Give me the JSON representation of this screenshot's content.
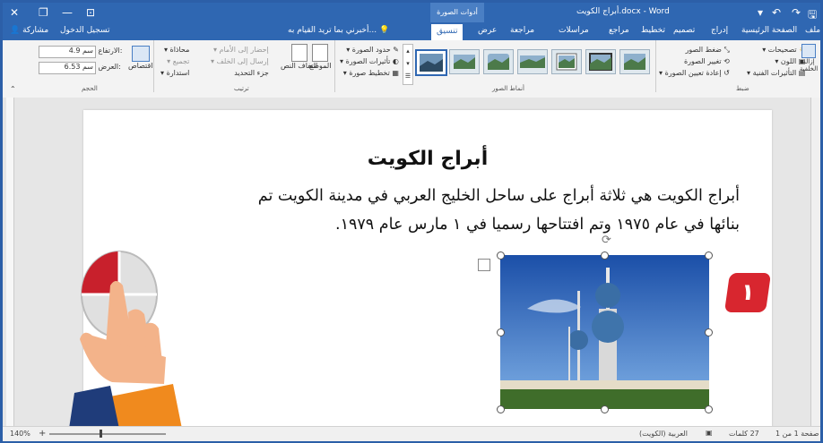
{
  "window": {
    "title": "أبراج الكويت.docx - Word",
    "context_tab_group": "أدوات الصورة",
    "sign_in": "تسجيل الدخول",
    "share": "مشاركة"
  },
  "tabs": [
    {
      "label": "ملف"
    },
    {
      "label": "الصفحة الرئيسية"
    },
    {
      "label": "إدراج"
    },
    {
      "label": "تصميم"
    },
    {
      "label": "تخطيط"
    },
    {
      "label": "مراجع"
    },
    {
      "label": "مراسلات"
    },
    {
      "label": "مراجعة"
    },
    {
      "label": "عرض"
    },
    {
      "label": "تنسيق"
    }
  ],
  "tell_me": "أخبرني بما تريد القيام به...",
  "ribbon": {
    "adjust": {
      "label": "ضبط",
      "remove_bg": "إزالة الخلفية",
      "corrections": "تصحيحات",
      "color": "اللون",
      "artistic": "التأثيرات الفنية",
      "compress": "ضغط الصور",
      "change": "تغيير الصورة",
      "reset": "إعادة تعيين الصورة"
    },
    "styles": {
      "label": "أنماط الصور",
      "border": "حدود الصورة",
      "effects": "تأثيرات الصورة",
      "layout": "تخطيط صورة"
    },
    "arrange": {
      "label": "ترتيب",
      "position": "الموضع",
      "wrap": "التفاف النص",
      "forward": "إحضار إلى الأمام",
      "backward": "إرسال إلى الخلف",
      "selection": "جزء التحديد",
      "align": "محاذاة",
      "group": "تجميع",
      "rotate": "استدارة"
    },
    "size": {
      "label": "الحجم",
      "crop": "اقتصاص",
      "height_label": "الارتفاع:",
      "height_value": "4.9 سم",
      "width_label": "العرض:",
      "width_value": "6.53 سم"
    }
  },
  "document": {
    "heading": "أبراج الكويت",
    "para_line1": "أبراج الكويت هي ثلاثة أبراج على ساحل الخليج العربي في مدينة الكويت تم",
    "para_line2": "بنائها في عام ١٩٧٥ وتم افتتاحها رسميا في ١ مارس عام ١٩٧٩."
  },
  "step_badge": "١",
  "status": {
    "page": "صفحة 1 من 1",
    "words": "27 كلمات",
    "language": "العربية (الكويت)",
    "zoom": "140%"
  },
  "colors": {
    "accent": "#2f67b2",
    "badge": "#d8262f"
  }
}
